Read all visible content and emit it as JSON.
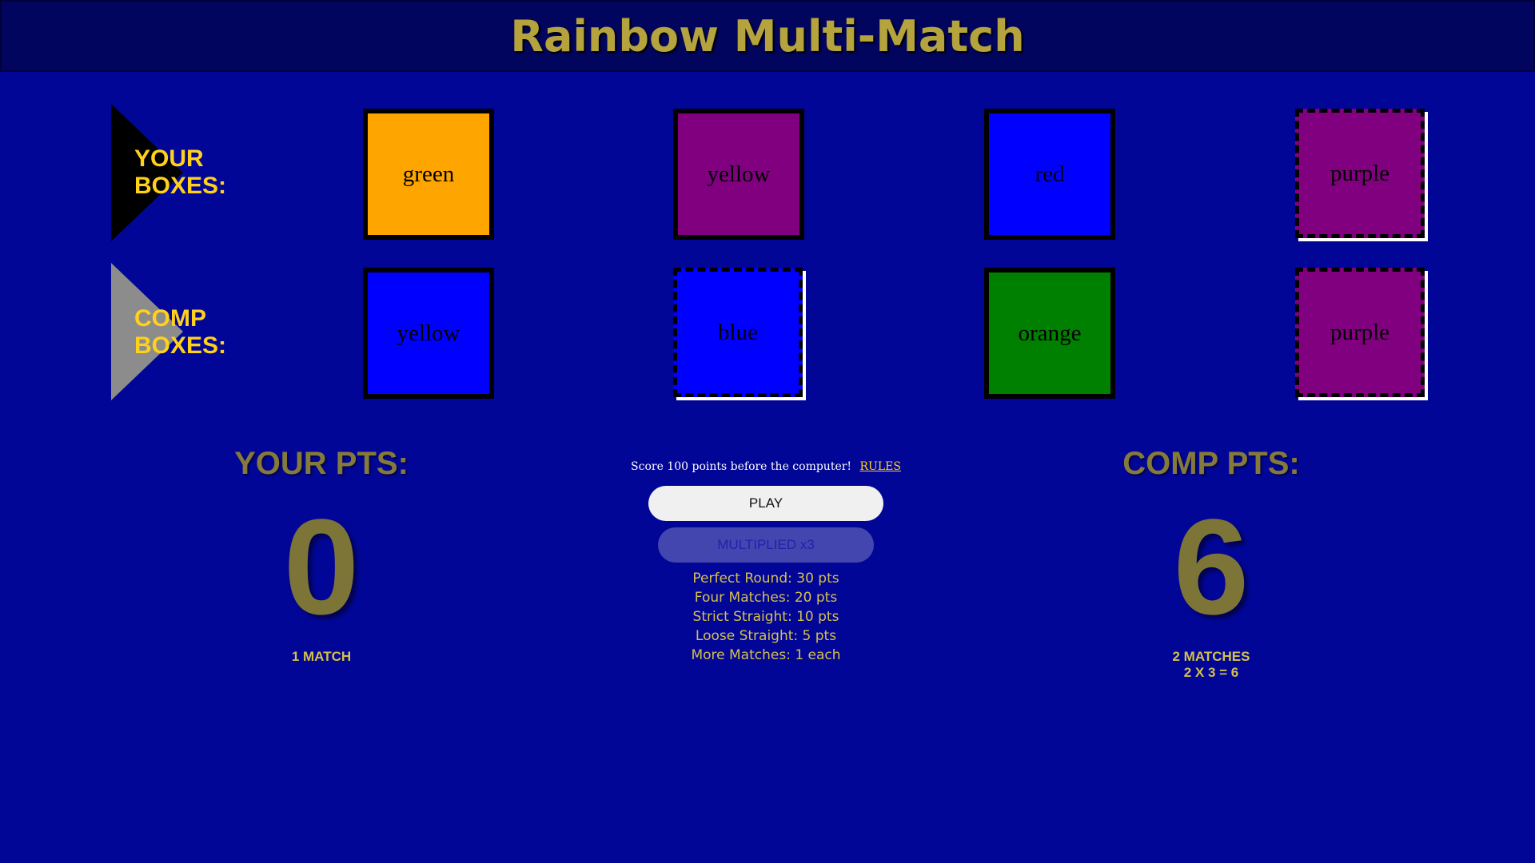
{
  "header": {
    "title": "Rainbow Multi-Match"
  },
  "your_row": {
    "label_line1": "YOUR",
    "label_line2": "BOXES:",
    "boxes": [
      {
        "text": "green",
        "color": "#ffa500",
        "dashed": false
      },
      {
        "text": "yellow",
        "color": "#800080",
        "dashed": false
      },
      {
        "text": "red",
        "color": "#0000ff",
        "dashed": false
      },
      {
        "text": "purple",
        "color": "#800080",
        "dashed": true
      }
    ]
  },
  "comp_row": {
    "label_line1": "COMP",
    "label_line2": "BOXES:",
    "boxes": [
      {
        "text": "yellow",
        "color": "#0000ff",
        "dashed": false
      },
      {
        "text": "blue",
        "color": "#0000ff",
        "dashed": true
      },
      {
        "text": "orange",
        "color": "#008000",
        "dashed": false
      },
      {
        "text": "purple",
        "color": "#800080",
        "dashed": true
      }
    ]
  },
  "your_score": {
    "label": "YOUR PTS:",
    "value": "0",
    "detail_line1": "1 MATCH",
    "detail_line2": ""
  },
  "comp_score": {
    "label": "COMP PTS:",
    "value": "6",
    "detail_line1": "2 MATCHES",
    "detail_line2": "2 X 3 = 6"
  },
  "center": {
    "instructions": "Score 100 points before the computer!",
    "rules_link": "RULES",
    "play_label": "PLAY",
    "multiplier_label": "MULTIPLIED x3",
    "scoring": [
      "Perfect Round: 30 pts",
      "Four Matches: 20 pts",
      "Strict Straight: 10 pts",
      "Loose Straight: 5 pts",
      "More Matches: 1 each"
    ]
  },
  "colors": {
    "background": "#020697",
    "header_bg": "#02055d",
    "title": "#b5a33d",
    "row_label": "#ffd11a",
    "points": "#7d7438"
  }
}
